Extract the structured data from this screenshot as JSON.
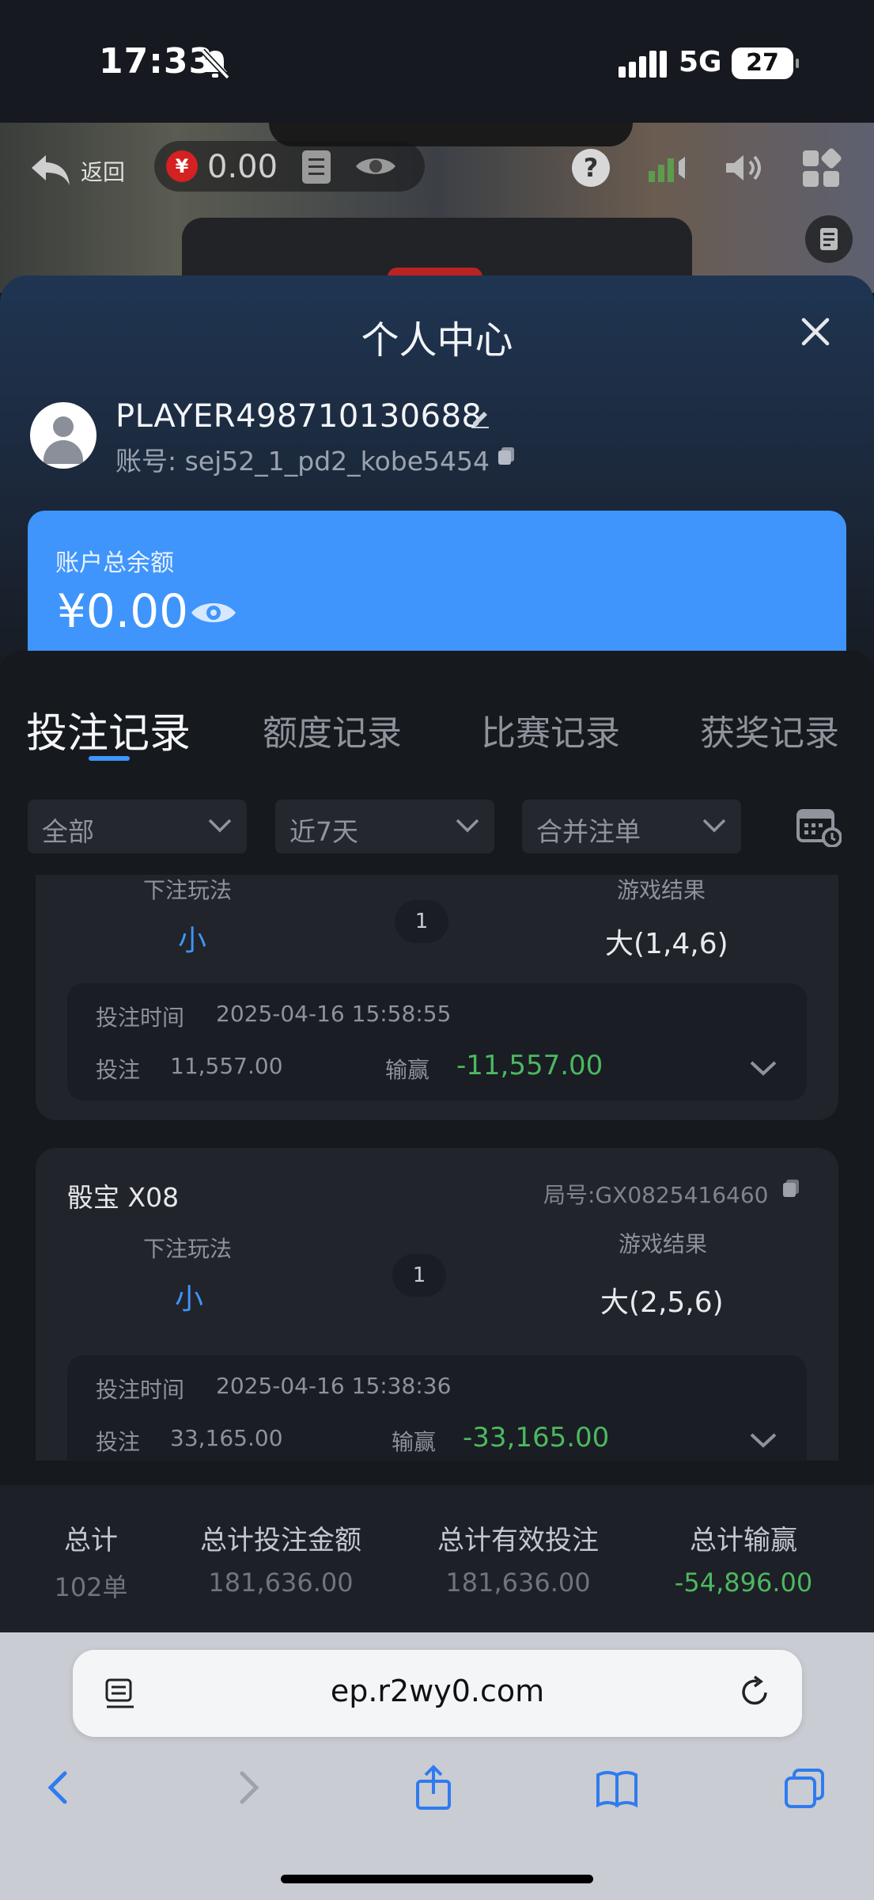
{
  "status": {
    "time": "17:33",
    "network": "5G",
    "battery": "27"
  },
  "game_header": {
    "back_label": "返回",
    "balance": "0.00",
    "yen_symbol": "¥"
  },
  "panel": {
    "title": "个人中心",
    "player_name": "PLAYER498710130688",
    "account": "账号: sej52_1_pd2_kobe5454",
    "balance_label": "账户总余额",
    "balance_amount": "¥0.00"
  },
  "tabs": [
    {
      "label": "投注记录"
    },
    {
      "label": "额度记录"
    },
    {
      "label": "比赛记录"
    },
    {
      "label": "获奖记录"
    }
  ],
  "filters": [
    {
      "value": "全部"
    },
    {
      "value": "近7天"
    },
    {
      "value": "合并注单"
    }
  ],
  "records": [
    {
      "game": "",
      "round": "",
      "bet_type_label": "下注玩法",
      "pick": "小",
      "count": "1",
      "result_label": "游戏结果",
      "result": "大(1,4,6)",
      "time_label": "投注时间",
      "time": "2025-04-16 15:58:55",
      "stake_label": "投注",
      "stake": "11,557.00",
      "winloss_label": "输赢",
      "winloss": "-11,557.00"
    },
    {
      "game": "骰宝 X08",
      "round": "局号:GX0825416460",
      "bet_type_label": "下注玩法",
      "pick": "小",
      "count": "1",
      "result_label": "游戏结果",
      "result": "大(2,5,6)",
      "time_label": "投注时间",
      "time": "2025-04-16 15:38:36",
      "stake_label": "投注",
      "stake": "33,165.00",
      "winloss_label": "输赢",
      "winloss": "-33,165.00"
    }
  ],
  "totals": {
    "count_label": "总计",
    "count_value": "102单",
    "bet_label": "总计投注金额",
    "bet_value": "181,636.00",
    "valid_label": "总计有效投注",
    "valid_value": "181,636.00",
    "winloss_label": "总计输赢",
    "winloss_value": "-54,896.00"
  },
  "browser": {
    "url": "ep.r2wy0.com"
  },
  "colors": {
    "accent": "#3f95fb",
    "loss": "#4cb860",
    "panel": "#171b22"
  }
}
